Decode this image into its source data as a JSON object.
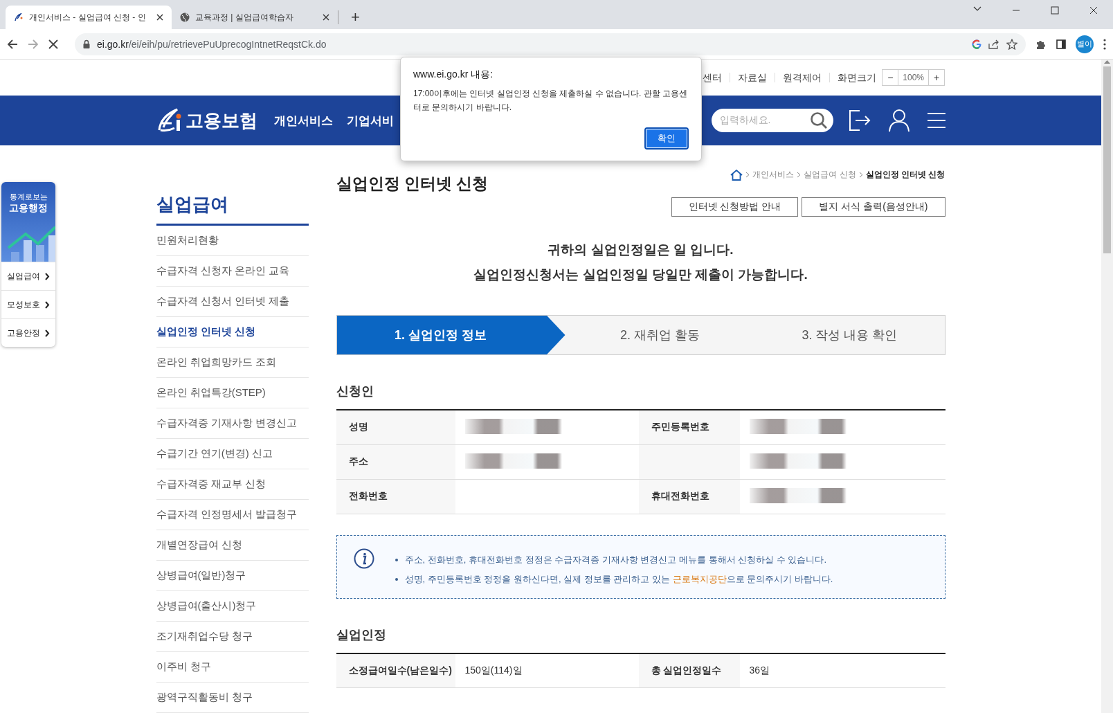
{
  "browser": {
    "tabs": [
      {
        "title": "개인서비스 - 실업급여 신청 - 인",
        "selected": true
      },
      {
        "title": "교육과정 | 실업급여학습자",
        "selected": false
      }
    ],
    "new_tab": "+",
    "url_host": "ei.go.kr",
    "url_path": "/ei/eih/pu/retrievePuUprecogIntnetReqstCk.do",
    "profile": "별이"
  },
  "dialog": {
    "title": "www.ei.go.kr 내용:",
    "message": "17:00이후에는 인터넷 실업인정 신청을 제출하실 수 없습니다. 관할 고용센터로 문의하시기 바랍니다.",
    "button": "확인"
  },
  "utility_links": [
    "센터",
    "자료실",
    "원격제어",
    "화면크기"
  ],
  "zoom": {
    "minus": "−",
    "value": "100%",
    "plus": "+"
  },
  "header": {
    "logo": "고용보험",
    "nav": [
      "개인서비스",
      "기업서비"
    ],
    "search_placeholder": "입력하세요."
  },
  "floating_widget": {
    "title_small": "통계로보는",
    "title_big": "고용행정",
    "links": [
      "실업급여",
      "모성보호",
      "고용안정"
    ]
  },
  "sidebar": {
    "title": "실업급여",
    "items": [
      {
        "label": "민원처리현황",
        "selected": false
      },
      {
        "label": "수급자격 신청자 온라인 교육",
        "selected": false
      },
      {
        "label": "수급자격 신청서 인터넷 제출",
        "selected": false
      },
      {
        "label": "실업인정 인터넷 신청",
        "selected": true
      },
      {
        "label": "온라인 취업희망카드 조회",
        "selected": false
      },
      {
        "label": "온라인 취업특강(STEP)",
        "selected": false
      },
      {
        "label": "수급자격증 기재사항 변경신고",
        "selected": false
      },
      {
        "label": "수급기간 연기(변경) 신고",
        "selected": false
      },
      {
        "label": "수급자격증 재교부 신청",
        "selected": false
      },
      {
        "label": "수급자격 인정명세서 발급청구",
        "selected": false
      },
      {
        "label": "개별연장급여 신청",
        "selected": false
      },
      {
        "label": "상병급여(일반)청구",
        "selected": false
      },
      {
        "label": "상병급여(출산시)청구",
        "selected": false
      },
      {
        "label": "조기재취업수당 청구",
        "selected": false
      },
      {
        "label": "이주비 청구",
        "selected": false
      },
      {
        "label": "광역구직활동비 청구",
        "selected": false
      }
    ]
  },
  "page_title": "실업인정 인터넷 신청",
  "breadcrumb": [
    "개인서비스",
    "실업급여 신청",
    "실업인정 인터넷 신청"
  ],
  "buttons": [
    "인터넷 신청방법 안내",
    "별지 서식 출력(음성안내)"
  ],
  "notice": [
    "귀하의 실업인정일은 일 입니다.",
    "실업인정신청서는 실업인정일 당일만 제출이 가능합니다."
  ],
  "steps": [
    {
      "label": "1. 실업인정 정보",
      "selected": true
    },
    {
      "label": "2. 재취업 활동",
      "selected": false
    },
    {
      "label": "3. 작성 내용 확인",
      "selected": false
    }
  ],
  "applicant": {
    "title": "신청인",
    "rows": [
      [
        {
          "label": "성명",
          "redacted": true
        },
        {
          "label": "주민등록번호",
          "redacted": true
        }
      ],
      [
        {
          "label": "주소",
          "redacted": true
        },
        {
          "redacted": true
        }
      ],
      [
        {
          "label": "전화번호",
          "redacted": false
        },
        {
          "label": "휴대전화번호",
          "redacted": true
        }
      ]
    ]
  },
  "info": [
    {
      "text": "주소, 전화번호, 휴대전화번호 정정은 수급자격증 기재사항 변경신고 메뉴를 통해서 신청하실 수 있습니다."
    },
    {
      "text": "성명, 주민등록번호 정정을 원하신다면, 실제 정보를 관리하고 있는 ",
      "highlight": "근로복지공단",
      "after": "으로 문의주시기 바랍니다."
    }
  ],
  "recognition": {
    "title": "실업인정",
    "rows": [
      [
        {
          "label": "소정급여일수(남은일수)",
          "value": "150일(114)일"
        },
        {
          "label": "총 실업인정일수",
          "value": "36일"
        }
      ]
    ]
  }
}
